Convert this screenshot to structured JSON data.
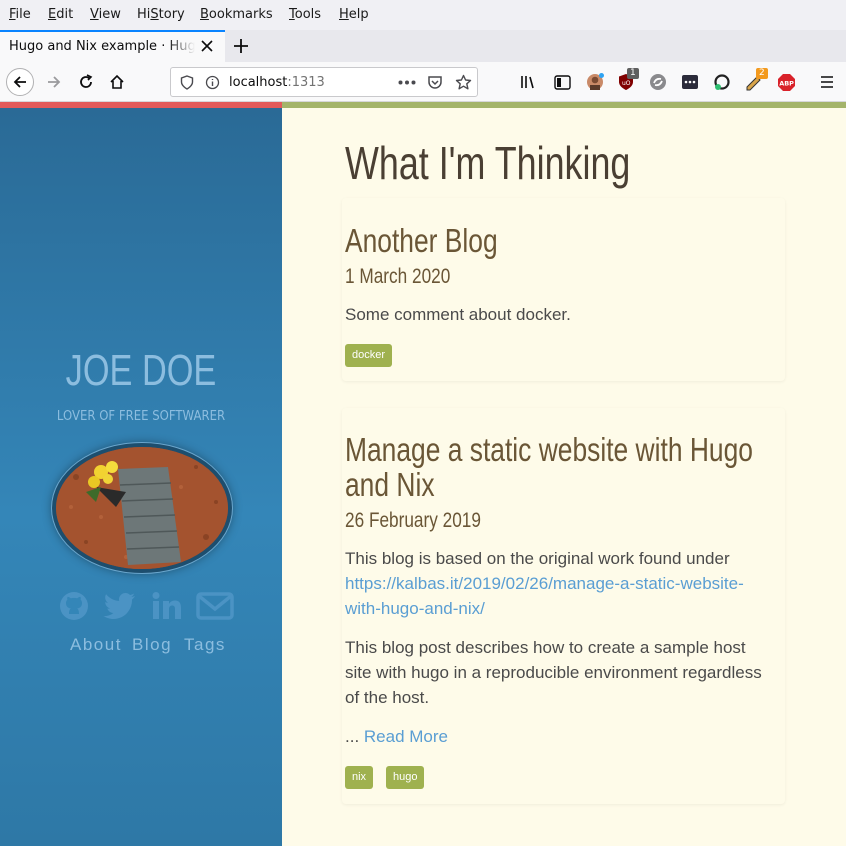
{
  "menubar": {
    "items": [
      {
        "key": "F",
        "rest": "ile"
      },
      {
        "key": "E",
        "rest": "dit"
      },
      {
        "key": "V",
        "rest": "iew"
      },
      {
        "key": "S",
        "pre": "Hi",
        "rest": "tory"
      },
      {
        "key": "B",
        "rest": "ookmarks"
      },
      {
        "key": "T",
        "rest": "ools"
      },
      {
        "key": "H",
        "rest": "elp"
      }
    ]
  },
  "tab": {
    "title": "Hugo and Nix example · Hugo"
  },
  "urlbar": {
    "host": "localhost",
    "port": ":1313"
  },
  "toolbar": {
    "ublock_badge": "1",
    "extension_badge": "2",
    "abp_label": "ABP"
  },
  "colors": {
    "sidebar": "#3486b8",
    "main_bg": "#fefbe9",
    "accent_red": "#e25a5a",
    "accent_green": "#a4b46a",
    "tag_bg": "#9fb14f",
    "link": "#5a9ed3"
  },
  "sidebar": {
    "author": "JOE DOE",
    "tagline": "LOVER OF FREE SOFTWARER",
    "social_icons": [
      "github-icon",
      "twitter-icon",
      "linkedin-icon",
      "mail-icon"
    ],
    "nav": [
      "About",
      "Blog",
      "Tags"
    ]
  },
  "main": {
    "title": "What I'm Thinking",
    "posts": [
      {
        "title": "Another Blog",
        "date": "1 March 2020",
        "summary": "Some comment about docker.",
        "tags": [
          "docker"
        ]
      },
      {
        "title_line1": "Manage a static website with Hugo",
        "title_line2": "and Nix",
        "date": "26 February 2019",
        "intro": "This blog is based on the original work found under",
        "link_line1": "https://kalbas.it/2019/02/26/manage-a-static-website-",
        "link_line2": "with-hugo-and-nix/",
        "para_line1": "This blog post describes how to create a sample host",
        "para_line2": "site with hugo in a reproducible environment regardless",
        "para_line3": "of the host.",
        "ellipsis": "...",
        "read_more": "Read More",
        "tags": [
          "nix",
          "hugo"
        ]
      }
    ]
  }
}
